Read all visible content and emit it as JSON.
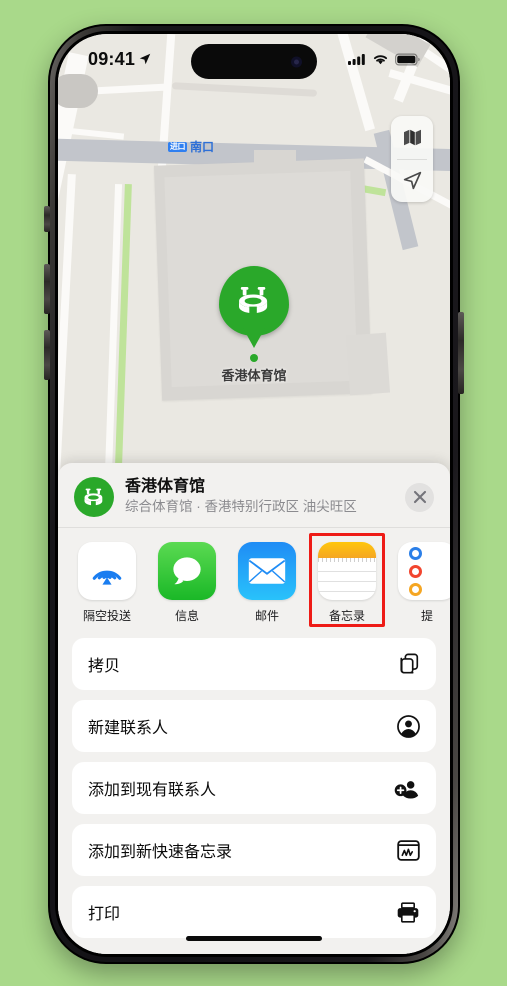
{
  "background_color": "#a9d98a",
  "status_bar": {
    "time": "09:41",
    "location_arrow": "location-arrow-icon",
    "cellular": "signal-bars-icon",
    "wifi": "wifi-icon",
    "battery": "battery-full-icon"
  },
  "map": {
    "pin_label": "香港体育馆",
    "pin_icon": "stadium-icon",
    "pin_color": "#2aa82a",
    "street_label": {
      "chip": "进口",
      "text": "南口"
    },
    "controls": [
      {
        "name": "map-layers-button",
        "icon": "folded-map-icon"
      },
      {
        "name": "locate-me-button",
        "icon": "navigation-arrow-icon"
      }
    ]
  },
  "share_sheet": {
    "header": {
      "icon": "stadium-icon",
      "title": "香港体育馆",
      "subtitle": "综合体育馆 · 香港特别行政区 油尖旺区",
      "close_label": "✕"
    },
    "apps": [
      {
        "label": "隔空投送",
        "icon": "airdrop-icon",
        "highlighted": false
      },
      {
        "label": "信息",
        "icon": "messages-icon",
        "highlighted": false
      },
      {
        "label": "邮件",
        "icon": "mail-icon",
        "highlighted": false
      },
      {
        "label": "备忘录",
        "icon": "notes-icon",
        "highlighted": true
      },
      {
        "label": "提",
        "icon": "reminders-icon",
        "highlighted": false
      }
    ],
    "highlight_color": "#ee1b16",
    "actions": [
      {
        "label": "拷贝",
        "icon": "copy-icon"
      },
      {
        "label": "新建联系人",
        "icon": "person-circle-icon"
      },
      {
        "label": "添加到现有联系人",
        "icon": "person-add-icon"
      },
      {
        "label": "添加到新快速备忘录",
        "icon": "quick-note-icon"
      },
      {
        "label": "打印",
        "icon": "printer-icon"
      }
    ]
  }
}
